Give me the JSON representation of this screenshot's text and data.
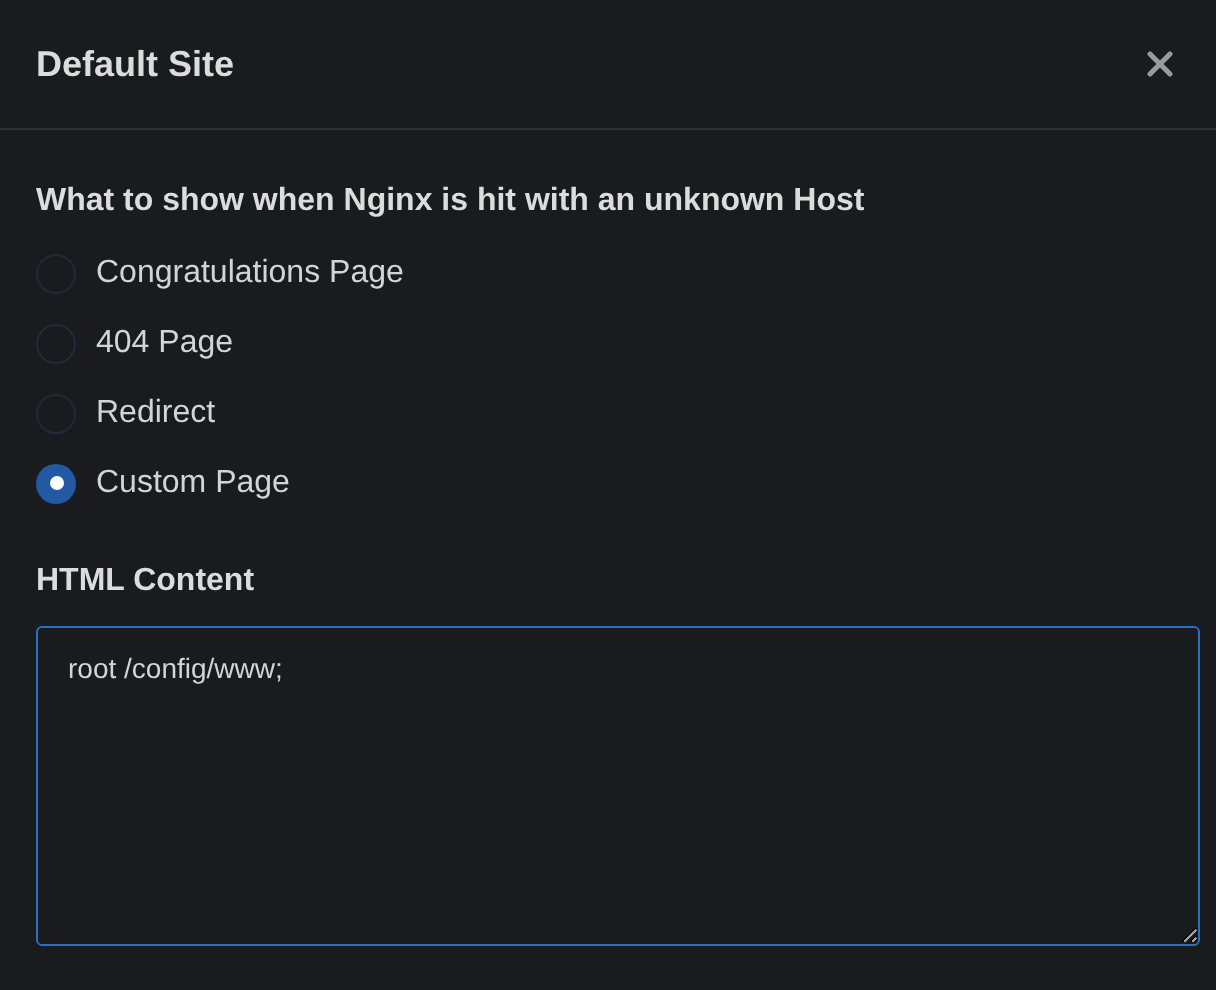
{
  "dialog": {
    "title": "Default Site"
  },
  "question": "What to show when Nginx is hit with an unknown Host",
  "options": [
    {
      "label": "Congratulations Page",
      "selected": false
    },
    {
      "label": "404 Page",
      "selected": false
    },
    {
      "label": "Redirect",
      "selected": false
    },
    {
      "label": "Custom Page",
      "selected": true
    }
  ],
  "html_content": {
    "label": "HTML Content",
    "value": "root /config/www;\n"
  }
}
